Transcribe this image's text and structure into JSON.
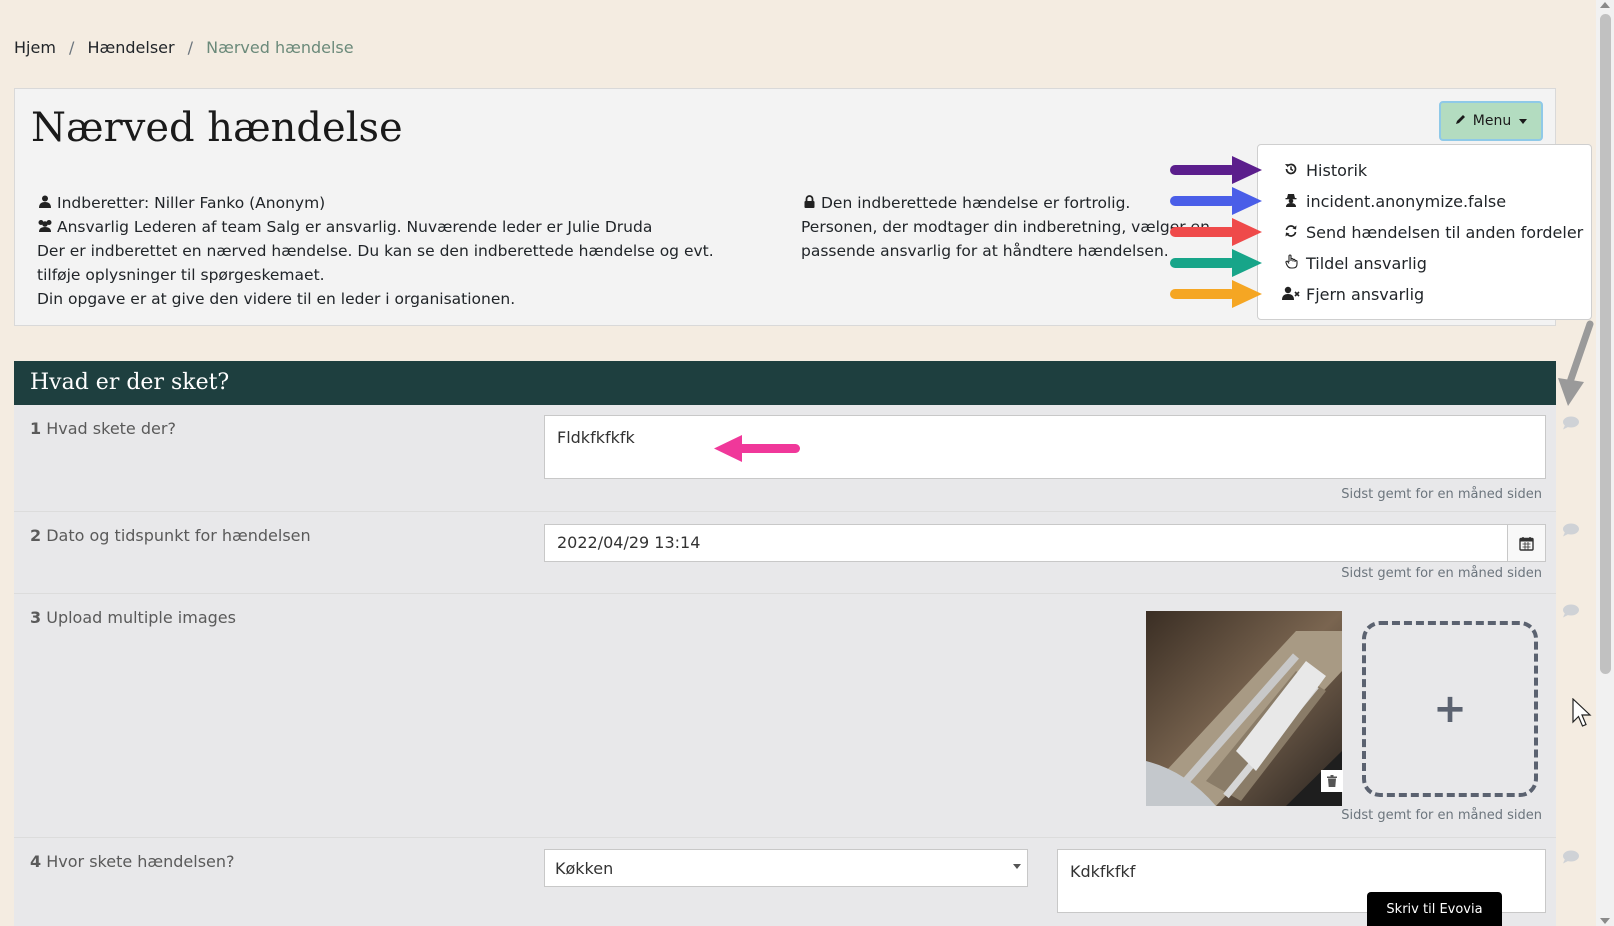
{
  "breadcrumb": {
    "home": "Hjem",
    "events": "Hændelser",
    "current": "Nærved hændelse",
    "separator": "/"
  },
  "header": {
    "title": "Nærved hændelse",
    "menu_label": "Menu",
    "reporter": "Indberetter: Niller Fanko (Anonym)",
    "responsible": "Ansvarlig Lederen af team Salg er ansvarlig. Nuværende leder er Julie Druda",
    "description_1": "Der er indberettet en nærved hændelse. Du kan se den indberettede hændelse og evt. tilføje oplysninger til spørgeskemaet.",
    "description_2": "Din opgave er at give den videre til en leder i organisationen.",
    "confidential": "Den indberettede hændelse er fortrolig.",
    "confidential_detail": "Personen, der modtager din indberetning, vælger en passende ansvarlig for at håndtere hændelsen."
  },
  "dropdown": {
    "items": [
      {
        "label": "Historik",
        "icon": "history-icon"
      },
      {
        "label": "incident.anonymize.false",
        "icon": "user-secret-icon"
      },
      {
        "label": "Send hændelsen til anden fordeler",
        "icon": "sync-icon"
      },
      {
        "label": "Tildel ansvarlig",
        "icon": "hand-pointer-icon"
      },
      {
        "label": "Fjern ansvarlig",
        "icon": "user-times-icon"
      }
    ],
    "arrow_colors": [
      "#5b1e8c",
      "#4a5ee8",
      "#ef4a4a",
      "#17a589",
      "#f5a623"
    ]
  },
  "section": {
    "title": "Hvad er der sket?"
  },
  "questions": [
    {
      "number": "1",
      "label": "Hvad skete der?",
      "value": "Fldkfkfkfk",
      "saved": "Sidst gemt for en måned siden"
    },
    {
      "number": "2",
      "label": "Dato og tidspunkt for hændelsen",
      "value": "2022/04/29 13:14",
      "saved": "Sidst gemt for en måned siden"
    },
    {
      "number": "3",
      "label": "Upload multiple images",
      "saved": "Sidst gemt for en måned siden",
      "add_label": "+"
    },
    {
      "number": "4",
      "label": "Hvor skete hændelsen?",
      "select_value": "Køkken",
      "text_value": "Kdkfkfkf"
    }
  ],
  "chat_button": "Skriv til Evovia",
  "colors": {
    "background": "#f4ece1",
    "section_header": "#1e3f3f",
    "menu_button": "#b3dcc0",
    "annotation_pink": "#f0389a"
  }
}
